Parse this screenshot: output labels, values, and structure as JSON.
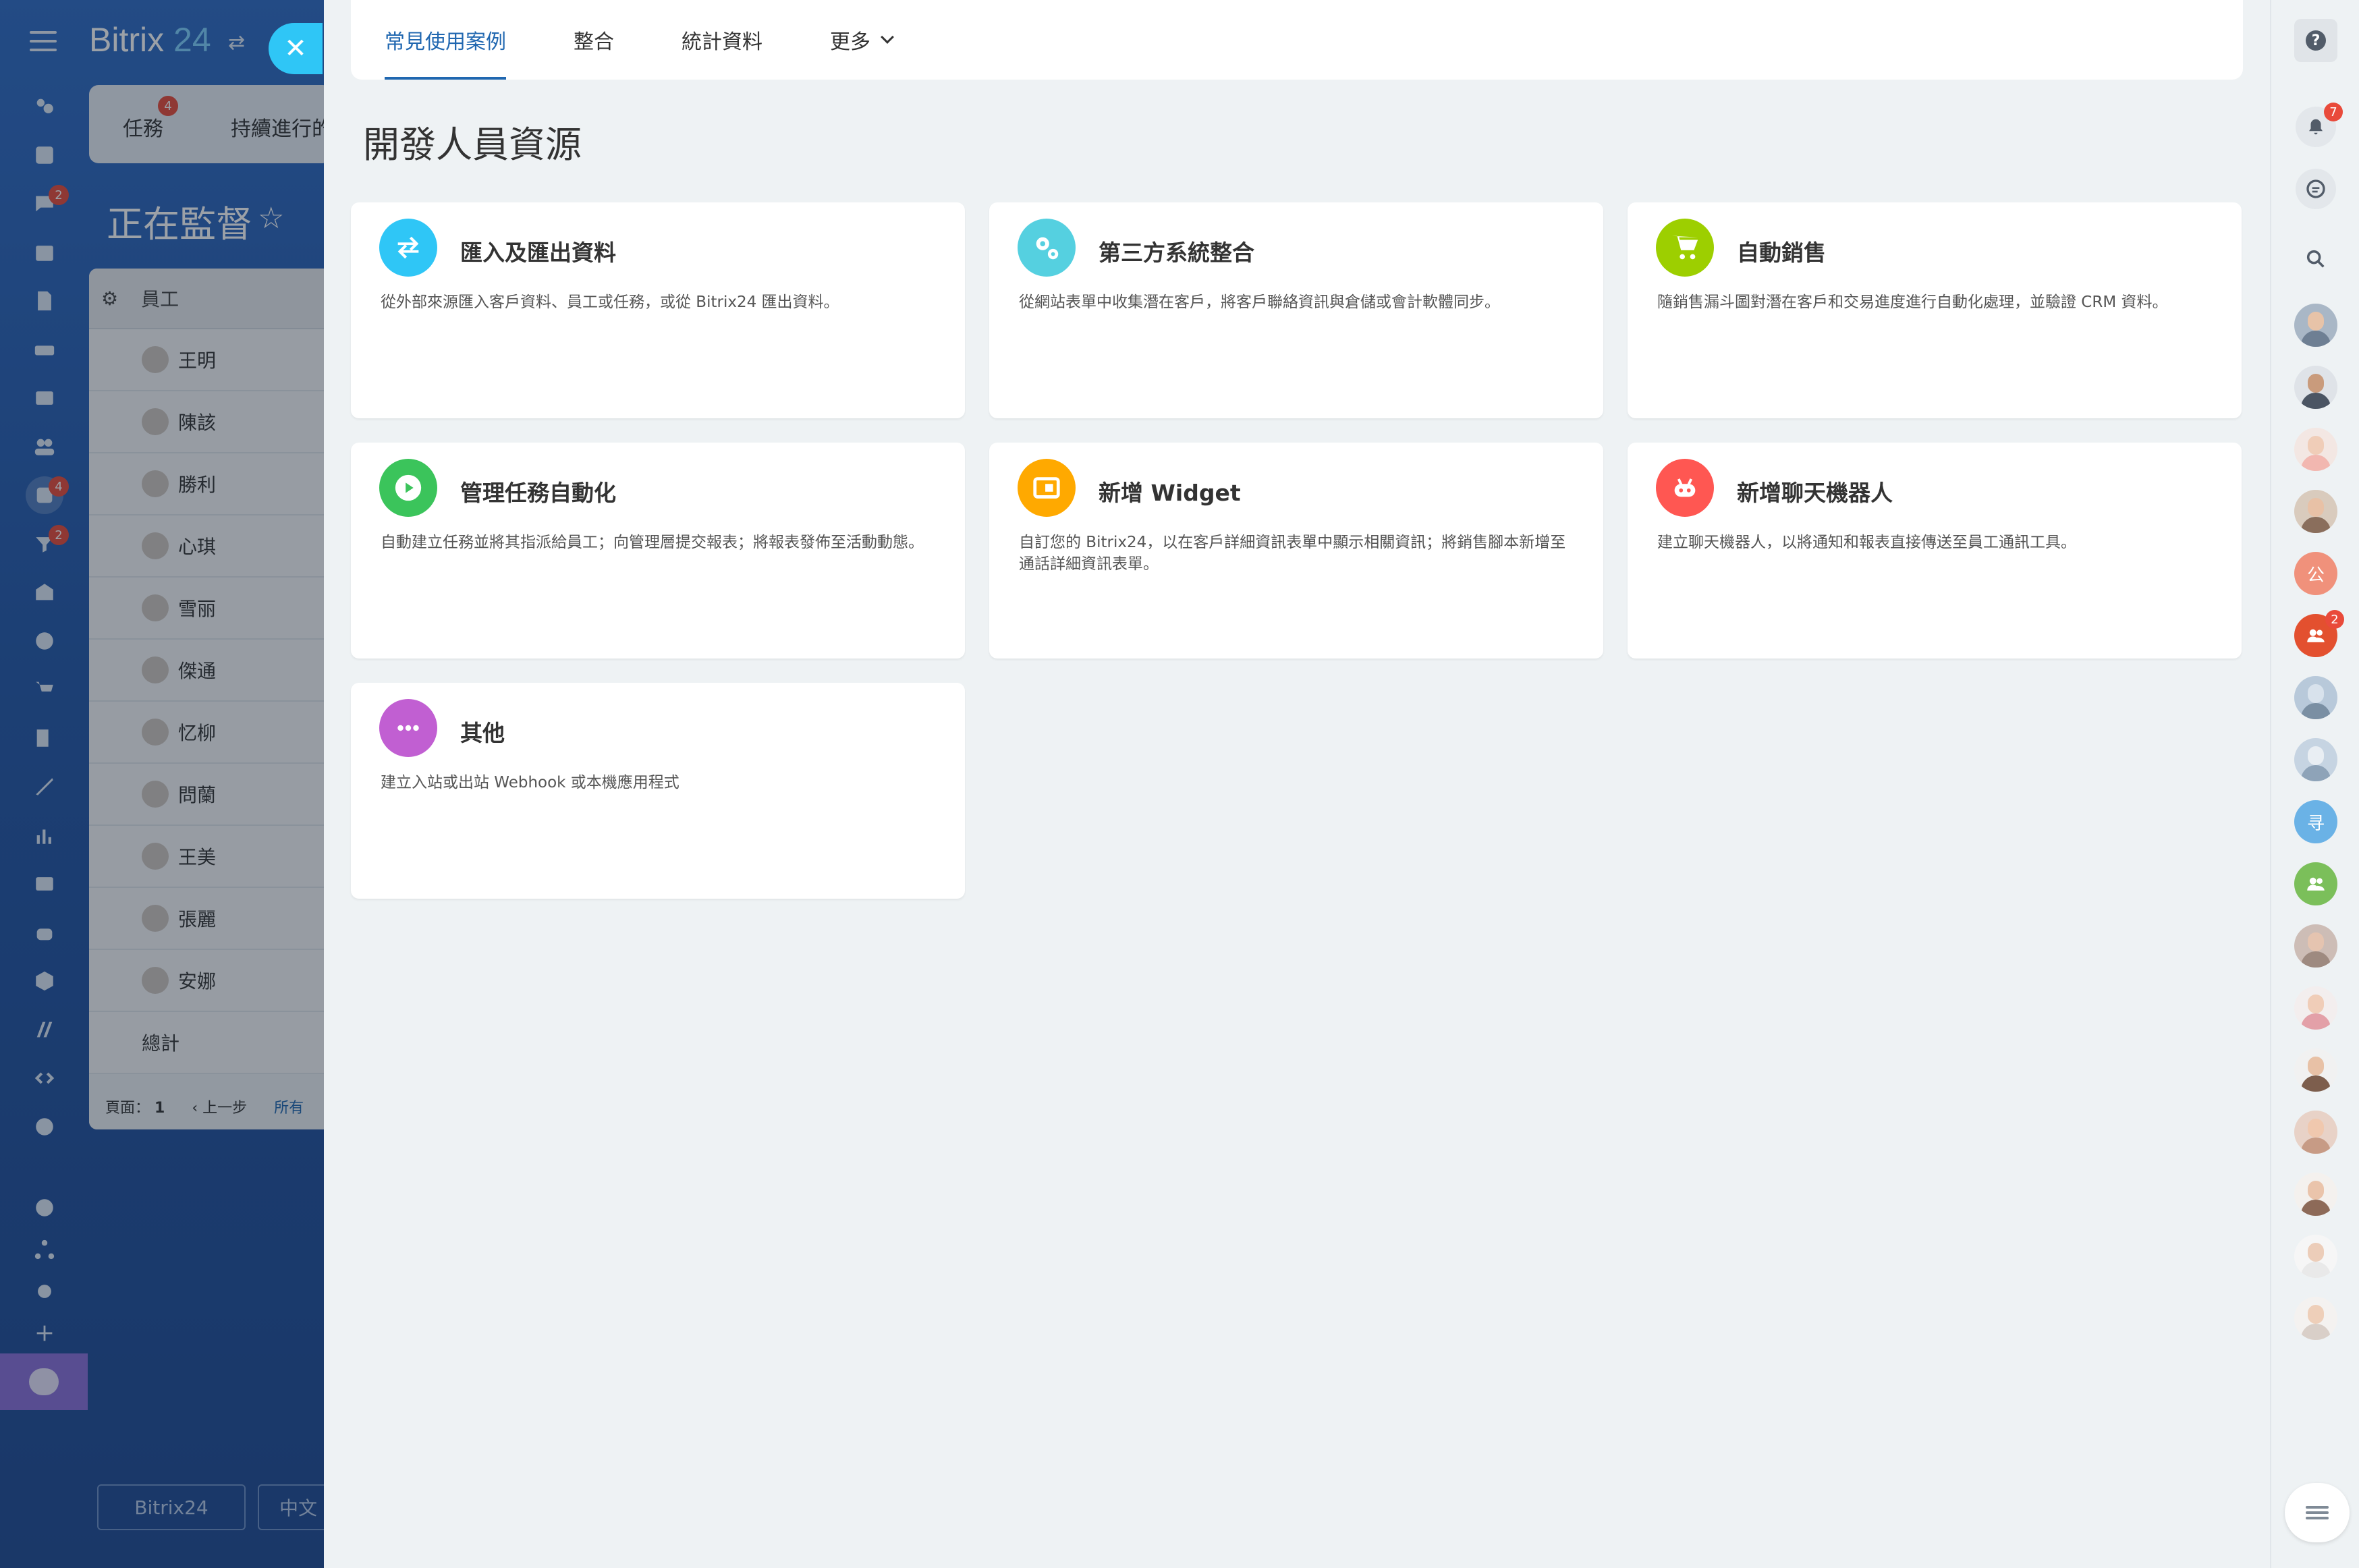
{
  "background": {
    "brand_name": "Bitrix",
    "brand_num": "24",
    "tabs": [
      "任務",
      "持續進行的"
    ],
    "tasks_badge": "4",
    "page_title": "正在監督",
    "table_header": "員工",
    "employees": [
      "王明",
      "陳該",
      "勝利",
      "心琪",
      "雪丽",
      "傑通",
      "忆柳",
      "問蘭",
      "王美",
      "張麗",
      "安娜"
    ],
    "total_label": "總計",
    "pager": {
      "page_label": "頁面：",
      "page_num": "1",
      "prev": "上一步",
      "all": "所有"
    },
    "footer_brand": "Bitrix24",
    "footer_lang": "中文",
    "rail_badges": {
      "chat": "2",
      "tasks": "4",
      "feed": "2"
    }
  },
  "nav": {
    "tabs": [
      {
        "label": "常見使用案例",
        "active": true
      },
      {
        "label": "整合",
        "active": false
      },
      {
        "label": "統計資料",
        "active": false
      },
      {
        "label": "更多",
        "active": false
      }
    ]
  },
  "section_title": "開發人員資源",
  "cards": [
    {
      "title": "匯入及匯出資料",
      "desc": "從外部來源匯入客戶資料、員工或任務，或從 Bitrix24 匯出資料。",
      "icon": "swap-arrows-icon",
      "color": "#2fc6f6"
    },
    {
      "title": "第三方系統整合",
      "desc": "從網站表單中收集潛在客戶，將客戶聯絡資訊與倉儲或會計軟體同步。",
      "icon": "gears-icon",
      "color": "#55d0e0"
    },
    {
      "title": "自動銷售",
      "desc": "隨銷售漏斗圖對潛在客戶和交易進度進行自動化處理，並驗證 CRM 資料。",
      "icon": "cart-icon",
      "color": "#9dcf00"
    },
    {
      "title": "管理任務自動化",
      "desc": "自動建立任務並將其指派給員工；向管理層提交報表；將報表發佈至活動動態。",
      "icon": "play-icon",
      "color": "#3bc45b"
    },
    {
      "title": "新增 Widget",
      "desc": "自訂您的 Bitrix24，以在客戶詳細資訊表單中顯示相關資訊；將銷售腳本新增至通話詳細資訊表單。",
      "icon": "widget-icon",
      "color": "#ffa900"
    },
    {
      "title": "新增聊天機器人",
      "desc": "建立聊天機器人，以將通知和報表直接傳送至員工通訊工具。",
      "icon": "robot-icon",
      "color": "#ff5752"
    },
    {
      "title": "其他",
      "desc": "建立入站或出站 Webhook 或本機應用程式",
      "icon": "dots-icon",
      "color": "#c15fd2"
    }
  ],
  "right_rail": {
    "help_label": "?",
    "notifications_badge": "7",
    "group_badge": "2",
    "initials": [
      "公",
      "寻"
    ]
  },
  "colors": {
    "accent": "#2067b0",
    "close_button": "#2fc6f6",
    "badge": "#e94a3a"
  }
}
